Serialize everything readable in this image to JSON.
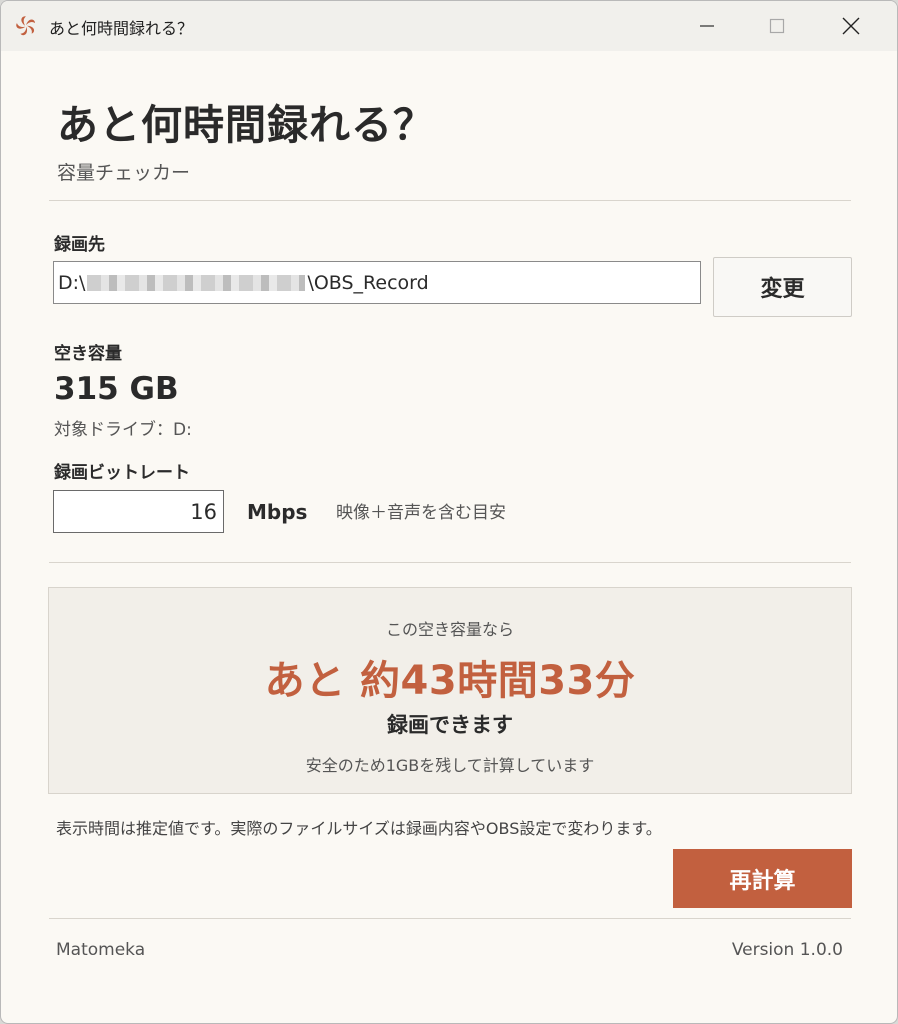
{
  "window": {
    "title": "あと何時間録れる？"
  },
  "header": {
    "title": "あと何時間録れる？",
    "subtitle": "容量チェッカー"
  },
  "destination": {
    "label": "録画先",
    "path_prefix": "D:\\",
    "path_suffix": "\\OBS_Record",
    "change_label": "変更"
  },
  "free_space": {
    "label": "空き容量",
    "value": "315 GB",
    "drive_text": "対象ドライブ：D:"
  },
  "bitrate": {
    "label": "録画ビットレート",
    "value": "16",
    "unit": "Mbps",
    "hint": "映像＋音声を含む目安"
  },
  "result": {
    "pre": "この空き容量なら",
    "main": "あと 約43時間33分",
    "post": "録画できます",
    "note": "安全のため1GBを残して計算しています"
  },
  "disclaimer": "表示時間は推定値です。実際のファイルサイズは録画内容やOBS設定で変わります。",
  "recalc_label": "再計算",
  "footer": {
    "brand": "Matomeka",
    "version": "Version 1.0.0"
  },
  "colors": {
    "accent": "#c2603f",
    "background": "#fbf9f4"
  }
}
